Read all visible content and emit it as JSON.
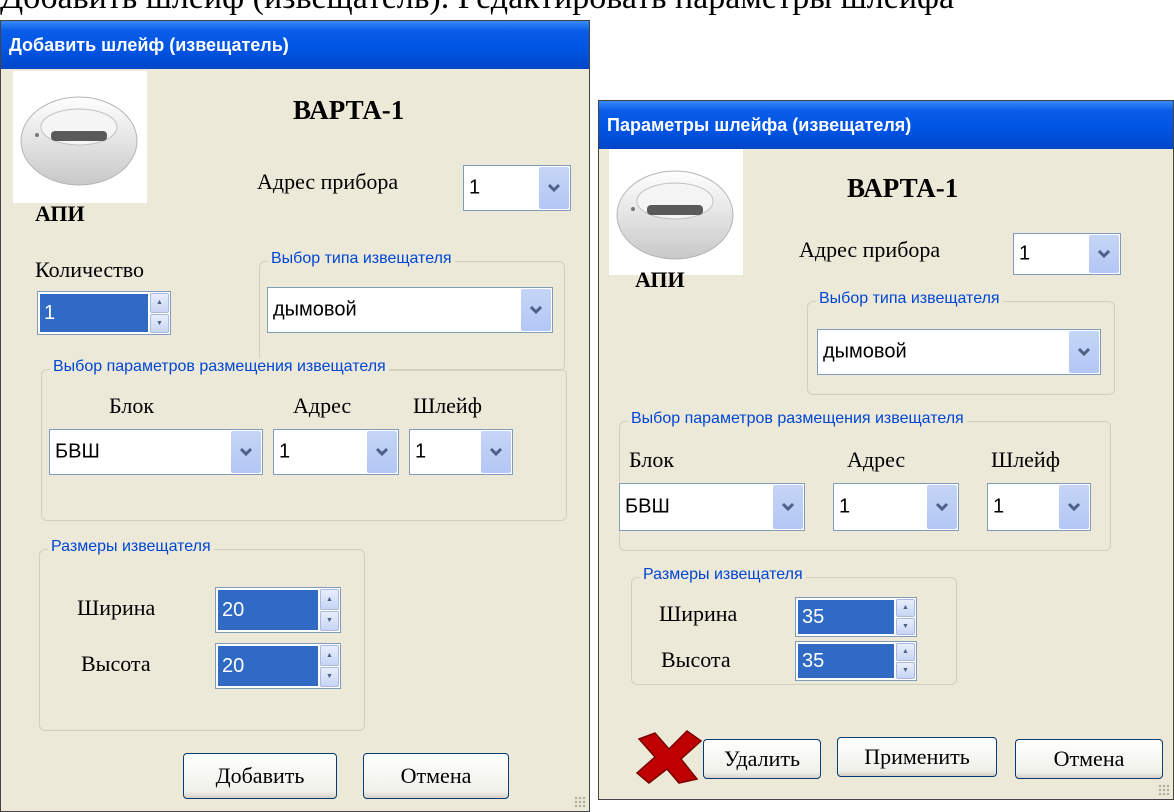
{
  "caption": "Добавить шлейф (извещатель). Редактировать параметры шлейфа",
  "add_dialog": {
    "title": "Добавить шлейф (извещатель)",
    "model": "ВАРТА-1",
    "detector_type_short": "АПИ",
    "device_address_label": "Адрес прибора",
    "device_address_value": "1",
    "quantity_label": "Количество",
    "quantity_value": "1",
    "detector_type_group": "Выбор типа извещателя",
    "detector_type_value": "дымовой",
    "placement_group": "Выбор параметров размещения извещателя",
    "block_label": "Блок",
    "address_label": "Адрес",
    "loop_label": "Шлейф",
    "block_value": "БВШ",
    "address_value": "1",
    "loop_value": "1",
    "size_group": "Размеры извещателя",
    "width_label": "Ширина",
    "width_value": "20",
    "height_label": "Высота",
    "height_value": "20",
    "add_button": "Добавить",
    "cancel_button": "Отмена"
  },
  "params_dialog": {
    "title": "Параметры шлейфа (извещателя)",
    "model": "ВАРТА-1",
    "detector_type_short": "АПИ",
    "device_address_label": "Адрес прибора",
    "device_address_value": "1",
    "detector_type_group": "Выбор типа извещателя",
    "detector_type_value": "дымовой",
    "placement_group": "Выбор параметров размещения извещателя",
    "block_label": "Блок",
    "address_label": "Адрес",
    "loop_label": "Шлейф",
    "block_value": "БВШ",
    "address_value": "1",
    "loop_value": "1",
    "size_group": "Размеры извещателя",
    "width_label": "Ширина",
    "width_value": "35",
    "height_label": "Высота",
    "height_value": "35",
    "delete_button": "Удалить",
    "apply_button": "Применить",
    "cancel_button": "Отмена"
  },
  "colors": {
    "titlebar": "#0054e3",
    "dialog_bg": "#ece9d8",
    "groupbox_label": "#0046d5",
    "selection": "#316ac5",
    "delete_icon": "#c00000"
  }
}
